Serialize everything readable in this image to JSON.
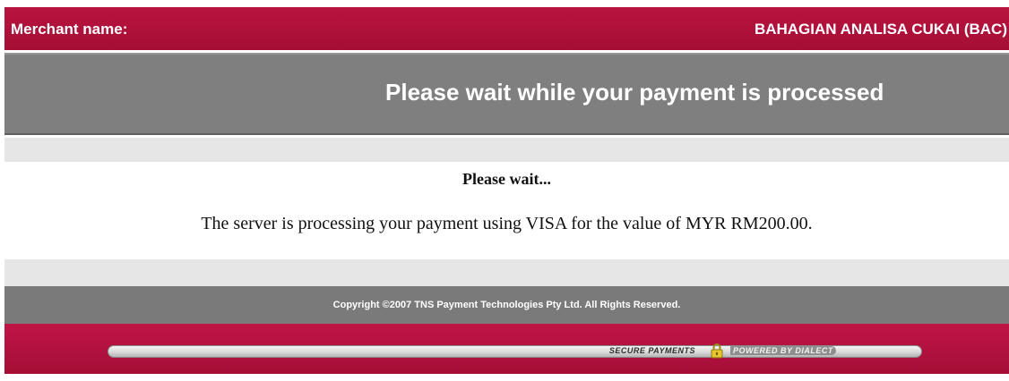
{
  "header": {
    "merchant_label": "Merchant name:",
    "merchant_value": "BAHAGIAN ANALISA CUKAI (BAC)"
  },
  "title_bar": {
    "title": "Please wait while your payment is processed"
  },
  "content": {
    "heading": "Please wait...",
    "message": "The server is processing your payment using VISA for the value of MYR RM200.00."
  },
  "copyright": {
    "text": "Copyright ©2007 TNS Payment Technologies Pty Ltd. All Rights Reserved."
  },
  "footer": {
    "secure_label": "SECURE PAYMENTS",
    "powered_label": "POWERED BY DIALECT",
    "lock_icon": "padlock-icon"
  },
  "colors": {
    "brand_red": "#a50e36",
    "title_gray": "#7f7f7f",
    "band_gray": "#e6e6e6"
  }
}
